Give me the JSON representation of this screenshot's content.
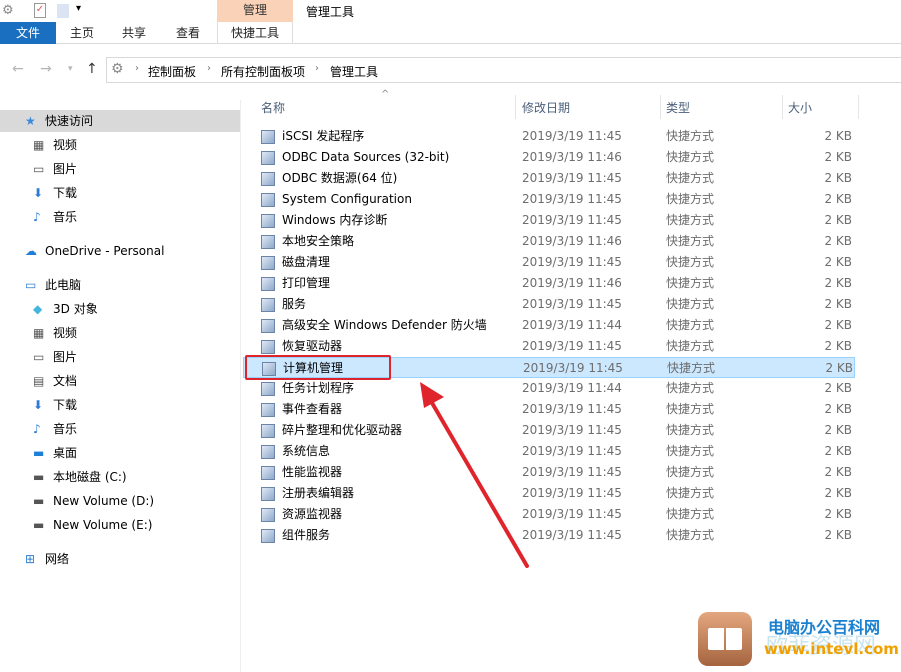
{
  "ribbon": {
    "context_group": "管理",
    "window_title": "管理工具",
    "tabs": [
      "文件",
      "主页",
      "共享",
      "查看",
      "快捷工具"
    ]
  },
  "address": {
    "crumbs": [
      "控制面板",
      "所有控制面板项",
      "管理工具"
    ]
  },
  "sidebar": {
    "items": [
      {
        "label": "快速访问",
        "icon": "star-icon",
        "level": 0,
        "selected": true
      },
      {
        "label": "视频",
        "icon": "video-icon",
        "level": 1
      },
      {
        "label": "图片",
        "icon": "pictures-icon",
        "level": 1
      },
      {
        "label": "下载",
        "icon": "download-icon",
        "level": 1
      },
      {
        "label": "音乐",
        "icon": "music-icon",
        "level": 1
      },
      {
        "label": "OneDrive - Personal",
        "icon": "cloud-icon",
        "level": 0,
        "gap": true
      },
      {
        "label": "此电脑",
        "icon": "computer-icon",
        "level": 0,
        "gap": true
      },
      {
        "label": "3D 对象",
        "icon": "cube-icon",
        "level": 1
      },
      {
        "label": "视频",
        "icon": "video-icon",
        "level": 1
      },
      {
        "label": "图片",
        "icon": "pictures-icon",
        "level": 1
      },
      {
        "label": "文档",
        "icon": "document-icon",
        "level": 1
      },
      {
        "label": "下载",
        "icon": "download-icon",
        "level": 1
      },
      {
        "label": "音乐",
        "icon": "music-icon",
        "level": 1
      },
      {
        "label": "桌面",
        "icon": "desktop-icon",
        "level": 1
      },
      {
        "label": "本地磁盘 (C:)",
        "icon": "drive-icon",
        "level": 1
      },
      {
        "label": "New Volume (D:)",
        "icon": "drive-icon",
        "level": 1
      },
      {
        "label": "New Volume (E:)",
        "icon": "drive-icon",
        "level": 1
      },
      {
        "label": "网络",
        "icon": "network-icon",
        "level": 0,
        "gap": true
      }
    ]
  },
  "columns": {
    "name": "名称",
    "date": "修改日期",
    "type": "类型",
    "size": "大小"
  },
  "files": [
    {
      "name": "iSCSI 发起程序",
      "date": "2019/3/19 11:45",
      "type": "快捷方式",
      "size": "2 KB"
    },
    {
      "name": "ODBC Data Sources (32-bit)",
      "date": "2019/3/19 11:46",
      "type": "快捷方式",
      "size": "2 KB"
    },
    {
      "name": "ODBC 数据源(64 位)",
      "date": "2019/3/19 11:45",
      "type": "快捷方式",
      "size": "2 KB"
    },
    {
      "name": "System Configuration",
      "date": "2019/3/19 11:45",
      "type": "快捷方式",
      "size": "2 KB"
    },
    {
      "name": "Windows 内存诊断",
      "date": "2019/3/19 11:45",
      "type": "快捷方式",
      "size": "2 KB"
    },
    {
      "name": "本地安全策略",
      "date": "2019/3/19 11:46",
      "type": "快捷方式",
      "size": "2 KB"
    },
    {
      "name": "磁盘清理",
      "date": "2019/3/19 11:45",
      "type": "快捷方式",
      "size": "2 KB"
    },
    {
      "name": "打印管理",
      "date": "2019/3/19 11:46",
      "type": "快捷方式",
      "size": "2 KB"
    },
    {
      "name": "服务",
      "date": "2019/3/19 11:45",
      "type": "快捷方式",
      "size": "2 KB"
    },
    {
      "name": "高级安全 Windows Defender 防火墙",
      "date": "2019/3/19 11:44",
      "type": "快捷方式",
      "size": "2 KB"
    },
    {
      "name": "恢复驱动器",
      "date": "2019/3/19 11:45",
      "type": "快捷方式",
      "size": "2 KB"
    },
    {
      "name": "计算机管理",
      "date": "2019/3/19 11:45",
      "type": "快捷方式",
      "size": "2 KB",
      "selected": true
    },
    {
      "name": "任务计划程序",
      "date": "2019/3/19 11:44",
      "type": "快捷方式",
      "size": "2 KB"
    },
    {
      "name": "事件查看器",
      "date": "2019/3/19 11:45",
      "type": "快捷方式",
      "size": "2 KB"
    },
    {
      "name": "碎片整理和优化驱动器",
      "date": "2019/3/19 11:45",
      "type": "快捷方式",
      "size": "2 KB"
    },
    {
      "name": "系统信息",
      "date": "2019/3/19 11:45",
      "type": "快捷方式",
      "size": "2 KB"
    },
    {
      "name": "性能监视器",
      "date": "2019/3/19 11:45",
      "type": "快捷方式",
      "size": "2 KB"
    },
    {
      "name": "注册表编辑器",
      "date": "2019/3/19 11:45",
      "type": "快捷方式",
      "size": "2 KB"
    },
    {
      "name": "资源监视器",
      "date": "2019/3/19 11:45",
      "type": "快捷方式",
      "size": "2 KB"
    },
    {
      "name": "组件服务",
      "date": "2019/3/19 11:45",
      "type": "快捷方式",
      "size": "2 KB"
    }
  ],
  "colors": {
    "accent": "#1a6fc1",
    "selection": "#cce8ff",
    "annotation": "#e0242b"
  },
  "watermark": {
    "line1": "电脑办公百科网",
    "line2": "www.intevl.com",
    "bg": "欧菲资源网"
  }
}
